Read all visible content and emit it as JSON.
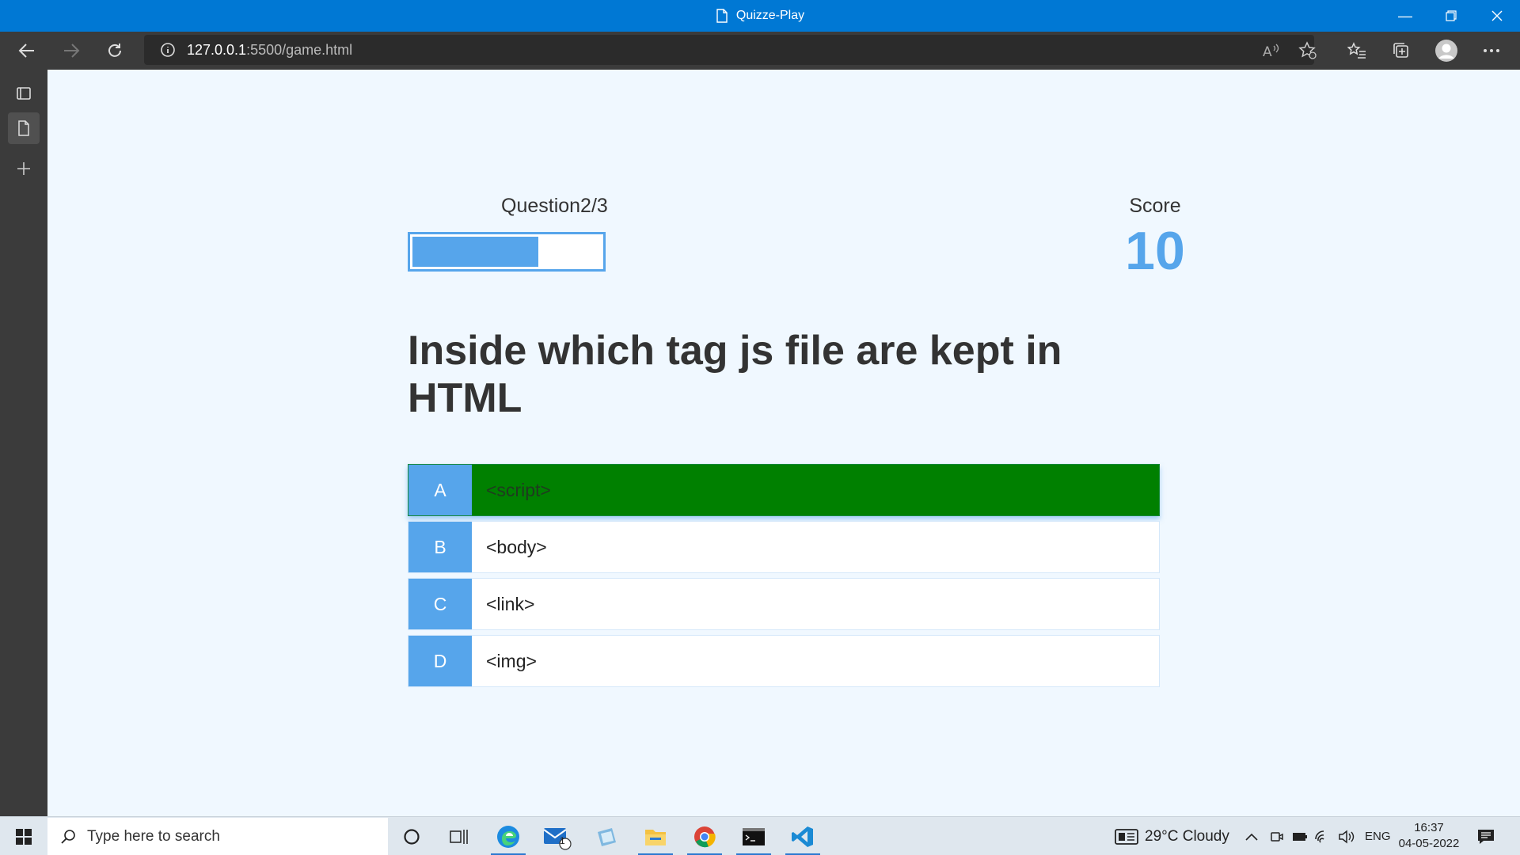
{
  "window": {
    "title": "Quizze-Play"
  },
  "browser": {
    "url_host": "127.0.0.1",
    "url_path": ":5500/game.html"
  },
  "hud": {
    "question_counter": "Question2/3",
    "progress_fraction": 0.667,
    "score_label": "Score",
    "score_value": "10"
  },
  "question": "Inside which tag js file are kept in HTML",
  "choices": [
    {
      "prefix": "A",
      "text": "<script>",
      "state": "correct"
    },
    {
      "prefix": "B",
      "text": "<body>",
      "state": "none"
    },
    {
      "prefix": "C",
      "text": "<link>",
      "state": "none"
    },
    {
      "prefix": "D",
      "text": "<img>",
      "state": "none"
    }
  ],
  "taskbar": {
    "search_placeholder": "Type here to search",
    "mail_badge": "1",
    "weather": "29°C  Cloudy",
    "language": "ENG",
    "time": "16:37",
    "date": "04-05-2022"
  },
  "colors": {
    "accent": "#56a5eb",
    "correct": "#008000",
    "titlebar": "#0078d4",
    "page_bg": "#f0f8ff"
  }
}
